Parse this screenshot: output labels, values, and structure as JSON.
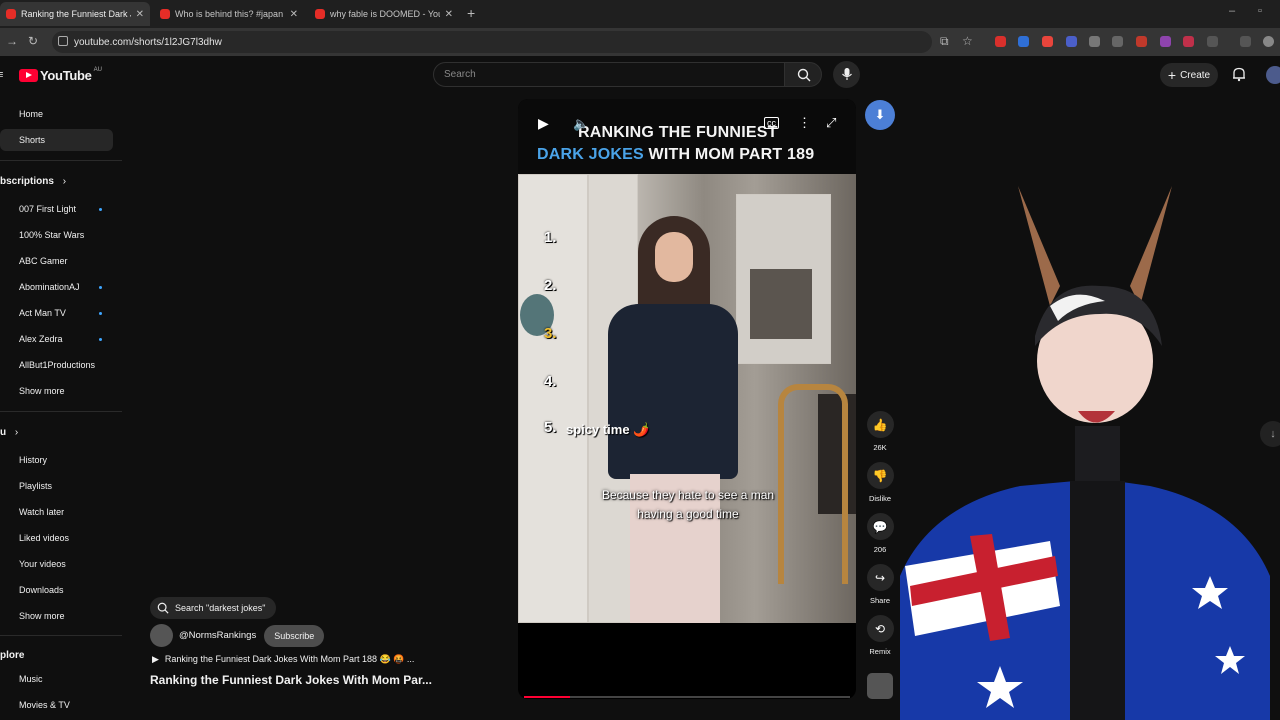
{
  "browser": {
    "tabs": [
      {
        "title": "Ranking the Funniest Dark Jok"
      },
      {
        "title": "Who is behind this? #japan #w"
      },
      {
        "title": "why fable is DOOMED - YouTu"
      }
    ],
    "url": "youtube.com/shorts/1l2JG7l3dhw"
  },
  "header": {
    "logo_text": "YouTube",
    "logo_region": "AU",
    "search_placeholder": "Search",
    "create_label": "Create"
  },
  "sidebar": {
    "main": [
      {
        "label": "Home"
      },
      {
        "label": "Shorts"
      }
    ],
    "subscriptions_heading": "bscriptions",
    "subscriptions": [
      {
        "label": "007 First Light"
      },
      {
        "label": "100% Star Wars"
      },
      {
        "label": "ABC Gamer"
      },
      {
        "label": "AbominationAJ"
      },
      {
        "label": "Act Man TV"
      },
      {
        "label": "Alex Zedra"
      },
      {
        "label": "AllBut1Productions"
      },
      {
        "label": "Show more"
      }
    ],
    "you_heading": "u",
    "you": [
      {
        "label": "History"
      },
      {
        "label": "Playlists"
      },
      {
        "label": "Watch later"
      },
      {
        "label": "Liked videos"
      },
      {
        "label": "Your videos"
      },
      {
        "label": "Downloads"
      },
      {
        "label": "Show more"
      }
    ],
    "explore_heading": "plore",
    "explore": [
      {
        "label": "Music"
      },
      {
        "label": "Movies & TV"
      }
    ]
  },
  "short": {
    "title_line1": "Ranking the Funniest",
    "title_line2_blue": "Dark Jokes",
    "title_line2_rest": " with Mom Part 189",
    "ranks": [
      "1.",
      "2.",
      "3.",
      "4.",
      "5."
    ],
    "rank5_text": "spicy time 🌶️",
    "caption_line1": "Because they hate to see a man",
    "caption_line2": "having a good time",
    "progress": 0.14,
    "likes": "26K",
    "dislike_label": "Dislike",
    "comments": "206",
    "share_label": "Share",
    "remix_label": "Remix",
    "search_chip": "Search \"darkest jokes\"",
    "channel": "@NormsRankings",
    "subscribe_label": "Subscribe",
    "description": "Ranking the Funniest Dark Jokes With Mom Part 188 😂 🤬 ...",
    "video_title": "Ranking the Funniest Dark Jokes With Mom Par..."
  },
  "colors": {
    "accent_blue": "#4aa3e8",
    "youtube_red": "#ff0033",
    "nav_button": "#4c7fd6"
  }
}
